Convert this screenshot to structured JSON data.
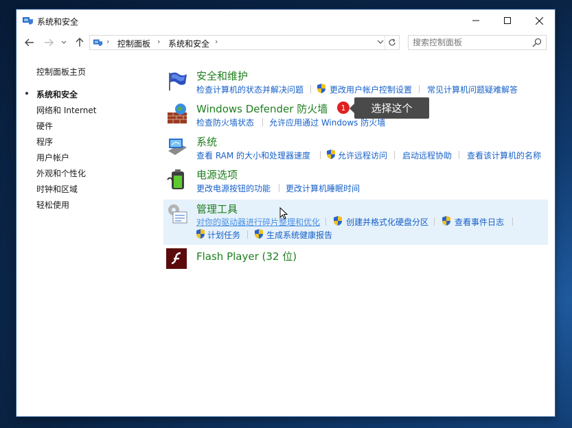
{
  "window": {
    "title": "系统和安全"
  },
  "nav": {
    "breadcrumb": [
      "控制面板",
      "系统和安全"
    ],
    "search_placeholder": "搜索控制面板"
  },
  "sidebar": {
    "items": [
      {
        "label": "控制面板主页"
      },
      {
        "label": "系统和安全",
        "active": true
      },
      {
        "label": "网络和 Internet"
      },
      {
        "label": "硬件"
      },
      {
        "label": "程序"
      },
      {
        "label": "用户帐户"
      },
      {
        "label": "外观和个性化"
      },
      {
        "label": "时钟和区域"
      },
      {
        "label": "轻松使用"
      }
    ]
  },
  "sections": {
    "security": {
      "title": "安全和维护",
      "links": [
        "检查计算机的状态并解决问题",
        "更改用户帐户控制设置",
        "常见计算机问题疑难解答"
      ]
    },
    "firewall": {
      "title": "Windows Defender 防火墙",
      "links": [
        "检查防火墙状态",
        "允许应用通过 Windows 防火墙"
      ]
    },
    "system": {
      "title": "系统",
      "links": [
        "查看 RAM 的大小和处理器速度",
        "允许远程访问",
        "启动远程协助",
        "查看该计算机的名称"
      ]
    },
    "power": {
      "title": "电源选项",
      "links": [
        "更改电源按钮的功能",
        "更改计算机睡眠时间"
      ]
    },
    "admin": {
      "title": "管理工具",
      "links": [
        "对你的驱动器进行碎片整理和优化",
        "创建并格式化硬盘分区",
        "查看事件日志",
        "计划任务",
        "生成系统健康报告"
      ]
    },
    "flash": {
      "title": "Flash Player (32 位)"
    }
  },
  "annotation": {
    "badge": "1",
    "tooltip": "选择这个"
  },
  "colors": {
    "section_title": "#1e7e1e",
    "link": "#1660c8",
    "hover_bg": "#e5f1fb",
    "badge": "#e02020"
  }
}
